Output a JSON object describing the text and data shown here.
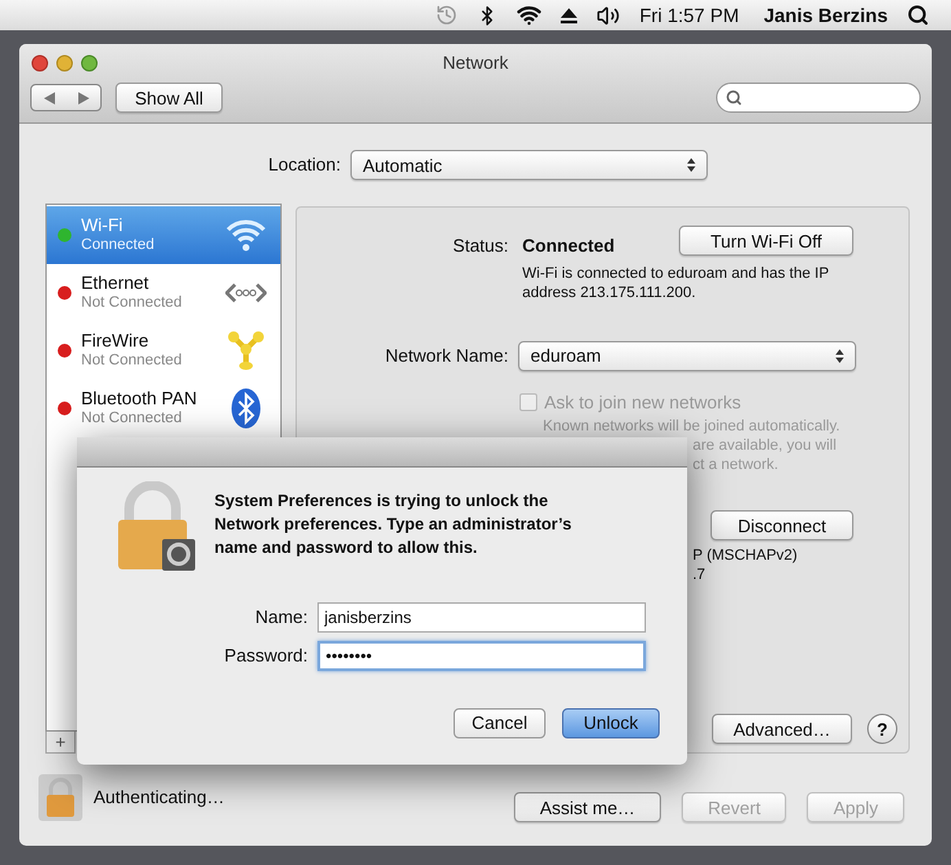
{
  "menubar": {
    "clock": "Fri 1:57 PM",
    "user": "Janis Berzins"
  },
  "window": {
    "title": "Network"
  },
  "toolbar": {
    "show_all": "Show All"
  },
  "location": {
    "label": "Location:",
    "value": "Automatic"
  },
  "services": [
    {
      "kind": "wifi",
      "name": "Wi-Fi",
      "status": "Connected",
      "selected": true,
      "color": "#2fb52f"
    },
    {
      "kind": "ethernet",
      "name": "Ethernet",
      "status": "Not Connected",
      "selected": false,
      "color": "#d81e1e"
    },
    {
      "kind": "firewire",
      "name": "FireWire",
      "status": "Not Connected",
      "selected": false,
      "color": "#d81e1e"
    },
    {
      "kind": "bluetooth",
      "name": "Bluetooth PAN",
      "status": "Not Connected",
      "selected": false,
      "color": "#d81e1e"
    }
  ],
  "detail": {
    "status_label": "Status:",
    "status_value": "Connected",
    "toggle_button": "Turn Wi-Fi Off",
    "status_description": "Wi-Fi is connected to eduroam and has the IP address 213.175.111.200.",
    "network_label": "Network Name:",
    "network_value": "eduroam",
    "ask_checkbox": {
      "label": "Ask to join new networks",
      "checked": false,
      "disabled": true
    },
    "ask_note_lines": [
      "Known networks will be joined automatically.",
      "are available, you will",
      "ct a network."
    ],
    "disconnect_button": "Disconnect",
    "auth_lines": [
      "P (MSCHAPv2)",
      ".7"
    ],
    "advanced_button": "Advanced…",
    "help_button": "?"
  },
  "sidebar_controls": {
    "add": "+"
  },
  "bottom": {
    "lock_text": "Authenticating…",
    "buttons": [
      {
        "label": "Assist me…",
        "disabled": false
      },
      {
        "label": "Revert",
        "disabled": true
      },
      {
        "label": "Apply",
        "disabled": true
      }
    ]
  },
  "dialog": {
    "message": "System Preferences is trying to unlock the Network preferences. Type an administrator’s name and password to allow this.",
    "fields": [
      {
        "label": "Name:",
        "value": "janisberzins",
        "focused": false
      },
      {
        "label": "Password:",
        "value": "••••••••",
        "focused": true
      }
    ],
    "buttons": [
      {
        "label": "Cancel",
        "default": false
      },
      {
        "label": "Unlock",
        "default": true
      }
    ]
  }
}
